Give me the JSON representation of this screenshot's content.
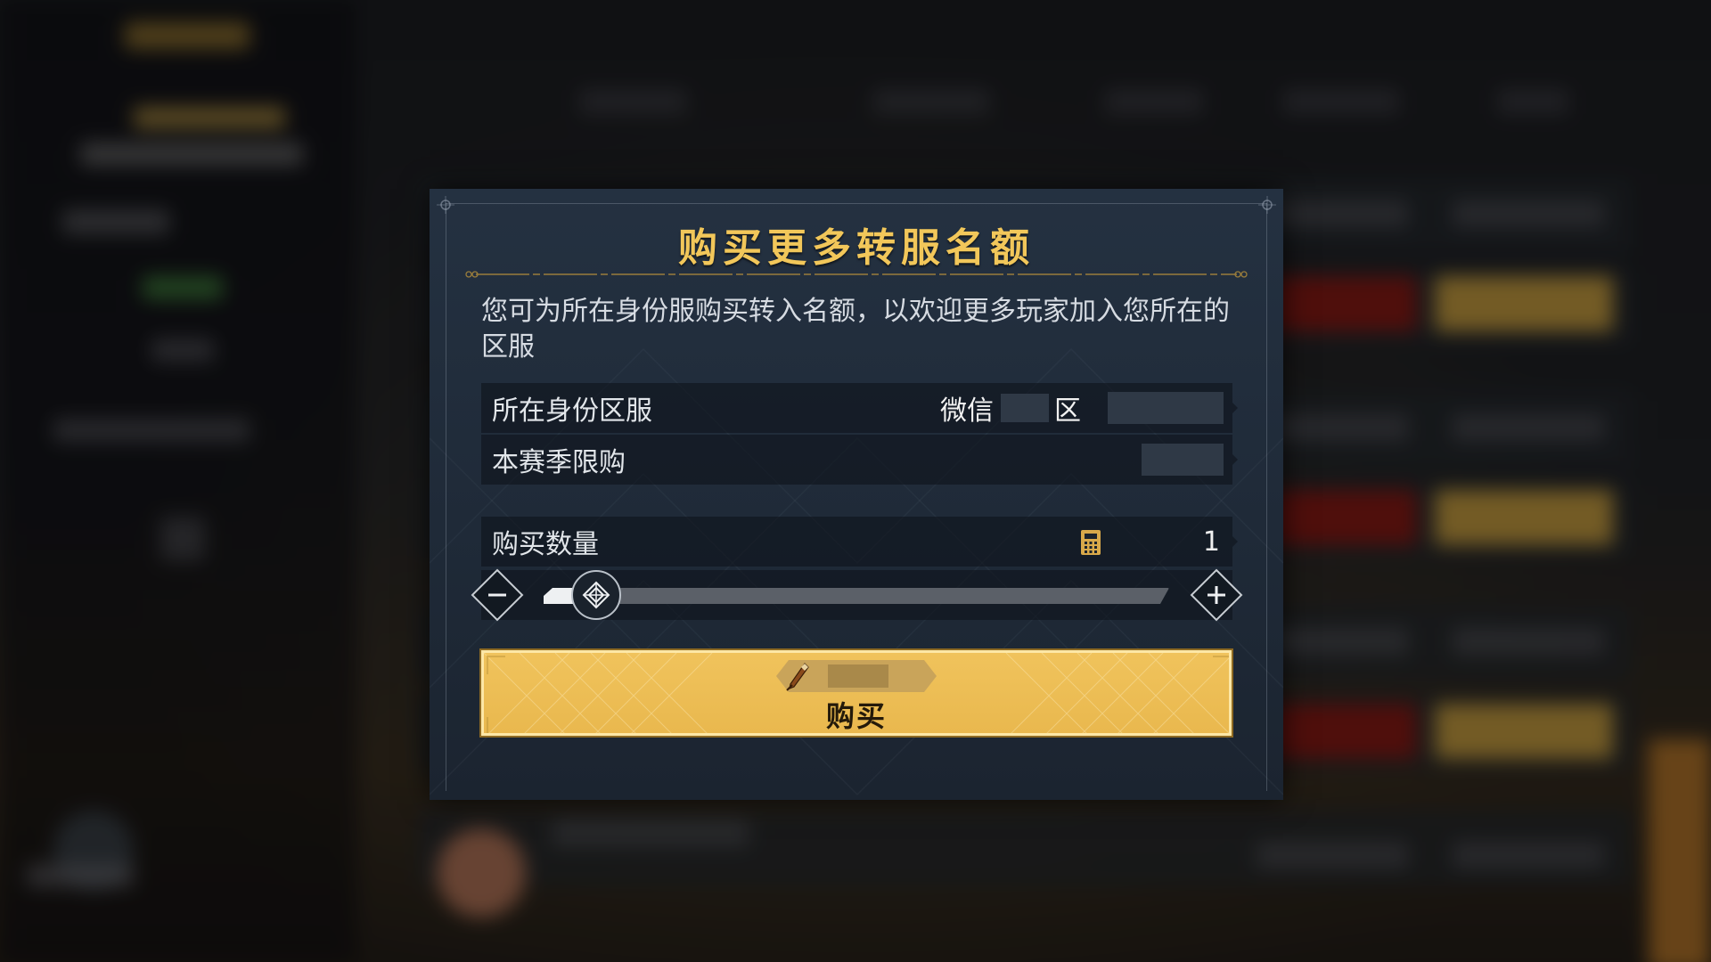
{
  "dialog": {
    "title": "购买更多转服名额",
    "description": "您可为所在身份服购买转入名额，以欢迎更多玩家加入您所在的区服",
    "server_row": {
      "label": "所在身份区服",
      "platform": "微信",
      "zone_suffix": "区"
    },
    "season_limit_row": {
      "label": "本赛季限购"
    },
    "quantity_row": {
      "label": "购买数量",
      "value": "1",
      "icon": "calculator-icon"
    },
    "slider": {
      "value_fraction": 0.05,
      "minus_icon": "minus-icon",
      "plus_icon": "plus-icon",
      "thumb_icon": "diamond-knot-icon"
    },
    "buy_button": {
      "label": "购买",
      "cost_icon": "quill-pen-icon"
    }
  },
  "colors": {
    "title_gold": "#f2c75a",
    "button_gold": "#e9b84e",
    "panel_bg": "#1f2a38"
  }
}
